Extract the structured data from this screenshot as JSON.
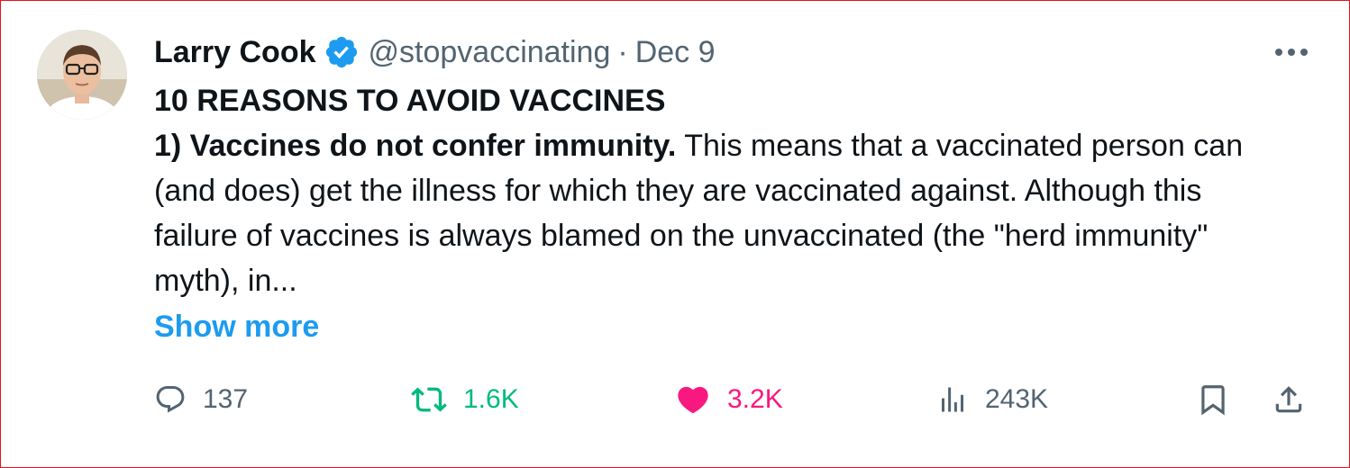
{
  "tweet": {
    "author_name": "Larry Cook",
    "handle": "@stopvaccinating",
    "separator": "·",
    "date": "Dec 9",
    "title": "10 REASONS TO AVOID VACCINES",
    "point_lead": "1) Vaccines do not confer immunity.",
    "point_body": " This means that a vaccinated person can (and does) get the illness for which they are vaccinated against. Although this failure of vaccines is always blamed on the unvaccinated (the \"herd immunity\" myth), in...",
    "show_more": "Show more"
  },
  "actions": {
    "replies": "137",
    "retweets": "1.6K",
    "likes": "3.2K",
    "views": "243K"
  },
  "icons": {
    "verified": "verified-badge-icon",
    "more": "more-dots-icon",
    "reply": "reply-icon",
    "retweet": "retweet-icon",
    "like": "heart-icon",
    "views": "views-bar-chart-icon",
    "bookmark": "bookmark-icon",
    "share": "share-icon"
  },
  "colors": {
    "text": "#0f1419",
    "muted": "#536471",
    "link": "#1d9bf0",
    "retweet": "#00ba7c",
    "like": "#f91880",
    "frame": "#e0161b"
  }
}
